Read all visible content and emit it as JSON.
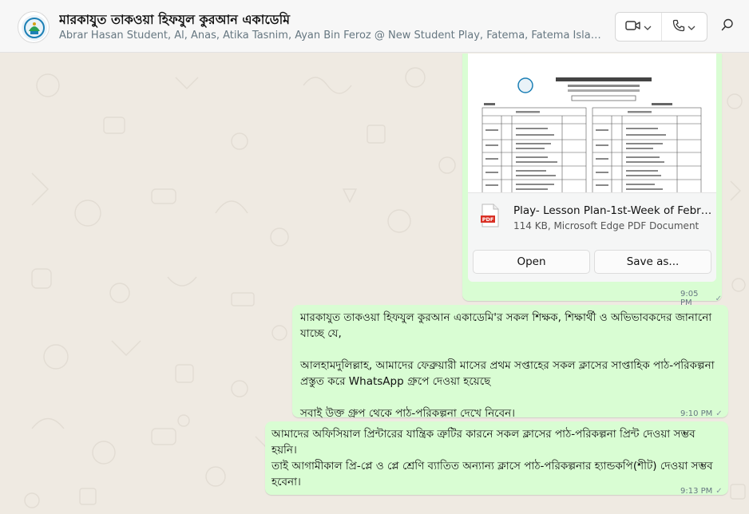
{
  "header": {
    "title": "মারকাযুত তাকওয়া হিফযুল কুরআন একাডেমি",
    "participants": "Abrar Hasan Student, Al, Anas, Atika Tasnim, Ayan Bin Feroz @ New Student Play, Fatema, Fatema Islam Student...",
    "video_icon": "video-camera-icon",
    "phone_icon": "phone-icon",
    "search_icon": "search-icon"
  },
  "messages": {
    "document": {
      "preview_title": "মারকাযুত তাকওয়া হিফযুল কুরআন একাডেমি",
      "file_name": "Play- Lesson Plan-1st-Week of February...",
      "file_meta": "114 KB, Microsoft Edge PDF Document",
      "open_label": "Open",
      "save_label": "Save as...",
      "time": "9:05 PM"
    },
    "m1": {
      "text": "মারকাযুত তাকওয়া হিফযুল কুরআন একাডেমি'র সকল শিক্ষক, শিক্ষার্থী ও অভিভাবকদের জানানো যাচ্ছে যে,\n\nআলহামদুলিল্লাহ, আমাদের ফেব্রুয়ারী মাসের প্রথম সপ্তাহের সকল ক্লাসের সাপ্তাহিক পাঠ-পরিকল্পনা প্রস্তুত করে WhatsApp গ্রুপে দেওয়া হয়েছে\n\nসবাই উক্ত গ্রুপ থেকে পাঠ-পরিকল্পনা দেখে নিবেন।",
      "time": "9:10 PM"
    },
    "m2": {
      "text": "আমাদের অফিসিয়াল প্রিন্টারের যান্ত্রিক ত্রুটির কারনে সকল ক্লাসের পাঠ-পরিকল্পনা প্রিন্ট দেওয়া সম্ভব হয়নি।\nতাই আগামীকাল প্রি-প্লে ও প্লে শ্রেণি ব্যাতিত অন্যান্য ক্লাসে পাঠ-পরিকল্পনার হ্যান্ডকপি(শীট) দেওয়া সম্ভব হবেনা।",
      "time": "9:13 PM"
    }
  },
  "colors": {
    "chat_bg": "#efeae2",
    "outgoing_bubble": "#d9fdd3",
    "header_bg": "#f7f7f7",
    "secondary_text": "#667781"
  }
}
